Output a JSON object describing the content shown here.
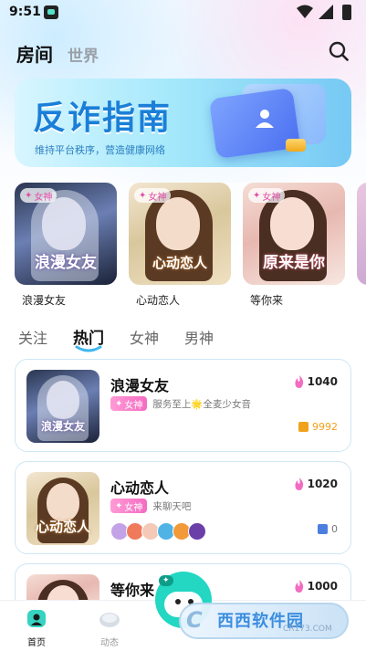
{
  "status_bar": {
    "time": "9:51"
  },
  "header": {
    "tabs": [
      {
        "label": "房间",
        "active": true
      },
      {
        "label": "世界",
        "active": false
      }
    ]
  },
  "banner": {
    "title": "反诈指南",
    "subtitle": "维持平台秩序，营造健康网络"
  },
  "featured": [
    {
      "name": "浪漫女友",
      "badge": "女神",
      "overlay": "浪漫女友"
    },
    {
      "name": "心动恋人",
      "badge": "女神",
      "overlay": "心动恋人"
    },
    {
      "name": "等你来",
      "badge": "女神",
      "overlay": "原来是你"
    }
  ],
  "category_tabs": [
    {
      "label": "关注",
      "active": false
    },
    {
      "label": "热门",
      "active": true
    },
    {
      "label": "女神",
      "active": false
    },
    {
      "label": "男神",
      "active": false
    }
  ],
  "rooms": [
    {
      "title": "浪漫女友",
      "badge": "女神",
      "desc": "服务至上🌟全麦少女音",
      "heat": "1040",
      "count": "9992",
      "overlay": "浪漫女友"
    },
    {
      "title": "心动恋人",
      "badge": "女神",
      "desc": "来聊天吧",
      "heat": "1020",
      "count": "0",
      "overlay": "心动恋人"
    },
    {
      "title": "等你来",
      "heat": "1000"
    }
  ],
  "bottom_nav": [
    {
      "label": "首页",
      "active": true
    },
    {
      "label": "动态",
      "active": false
    }
  ],
  "watermark": {
    "text": "西西软件园",
    "url": "CR173.COM"
  },
  "colors": {
    "accent_blue": "#1b7fd8",
    "badge_pink": "#f46cc2",
    "heat_pink": "#f46cc2",
    "count_orange": "#f0a21c",
    "count_blue": "#4c7de0",
    "card_border": "#cde7f5"
  }
}
